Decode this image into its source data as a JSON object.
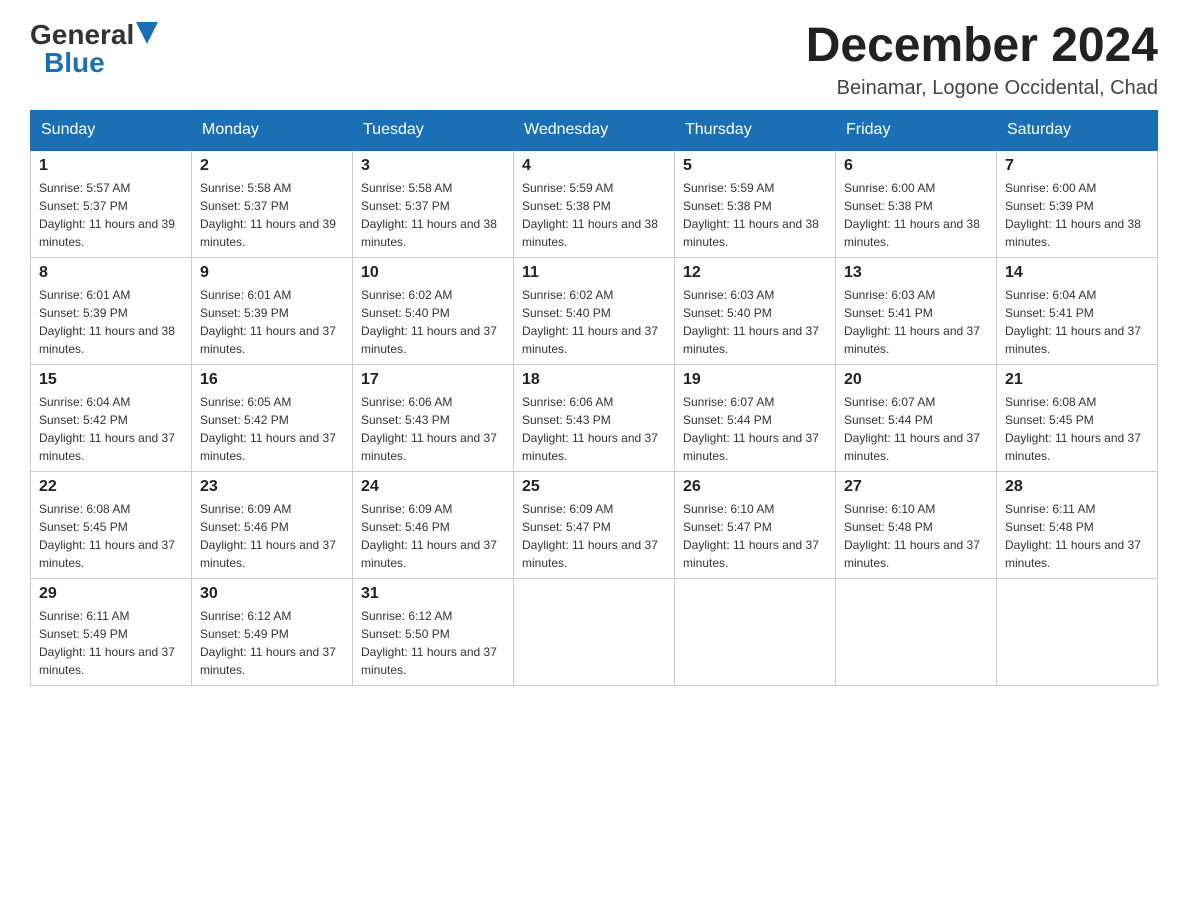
{
  "logo": {
    "general": "General",
    "blue": "Blue"
  },
  "title": "December 2024",
  "location": "Beinamar, Logone Occidental, Chad",
  "days_of_week": [
    "Sunday",
    "Monday",
    "Tuesday",
    "Wednesday",
    "Thursday",
    "Friday",
    "Saturday"
  ],
  "weeks": [
    [
      {
        "day": "1",
        "sunrise": "5:57 AM",
        "sunset": "5:37 PM",
        "daylight": "11 hours and 39 minutes."
      },
      {
        "day": "2",
        "sunrise": "5:58 AM",
        "sunset": "5:37 PM",
        "daylight": "11 hours and 39 minutes."
      },
      {
        "day": "3",
        "sunrise": "5:58 AM",
        "sunset": "5:37 PM",
        "daylight": "11 hours and 38 minutes."
      },
      {
        "day": "4",
        "sunrise": "5:59 AM",
        "sunset": "5:38 PM",
        "daylight": "11 hours and 38 minutes."
      },
      {
        "day": "5",
        "sunrise": "5:59 AM",
        "sunset": "5:38 PM",
        "daylight": "11 hours and 38 minutes."
      },
      {
        "day": "6",
        "sunrise": "6:00 AM",
        "sunset": "5:38 PM",
        "daylight": "11 hours and 38 minutes."
      },
      {
        "day": "7",
        "sunrise": "6:00 AM",
        "sunset": "5:39 PM",
        "daylight": "11 hours and 38 minutes."
      }
    ],
    [
      {
        "day": "8",
        "sunrise": "6:01 AM",
        "sunset": "5:39 PM",
        "daylight": "11 hours and 38 minutes."
      },
      {
        "day": "9",
        "sunrise": "6:01 AM",
        "sunset": "5:39 PM",
        "daylight": "11 hours and 37 minutes."
      },
      {
        "day": "10",
        "sunrise": "6:02 AM",
        "sunset": "5:40 PM",
        "daylight": "11 hours and 37 minutes."
      },
      {
        "day": "11",
        "sunrise": "6:02 AM",
        "sunset": "5:40 PM",
        "daylight": "11 hours and 37 minutes."
      },
      {
        "day": "12",
        "sunrise": "6:03 AM",
        "sunset": "5:40 PM",
        "daylight": "11 hours and 37 minutes."
      },
      {
        "day": "13",
        "sunrise": "6:03 AM",
        "sunset": "5:41 PM",
        "daylight": "11 hours and 37 minutes."
      },
      {
        "day": "14",
        "sunrise": "6:04 AM",
        "sunset": "5:41 PM",
        "daylight": "11 hours and 37 minutes."
      }
    ],
    [
      {
        "day": "15",
        "sunrise": "6:04 AM",
        "sunset": "5:42 PM",
        "daylight": "11 hours and 37 minutes."
      },
      {
        "day": "16",
        "sunrise": "6:05 AM",
        "sunset": "5:42 PM",
        "daylight": "11 hours and 37 minutes."
      },
      {
        "day": "17",
        "sunrise": "6:06 AM",
        "sunset": "5:43 PM",
        "daylight": "11 hours and 37 minutes."
      },
      {
        "day": "18",
        "sunrise": "6:06 AM",
        "sunset": "5:43 PM",
        "daylight": "11 hours and 37 minutes."
      },
      {
        "day": "19",
        "sunrise": "6:07 AM",
        "sunset": "5:44 PM",
        "daylight": "11 hours and 37 minutes."
      },
      {
        "day": "20",
        "sunrise": "6:07 AM",
        "sunset": "5:44 PM",
        "daylight": "11 hours and 37 minutes."
      },
      {
        "day": "21",
        "sunrise": "6:08 AM",
        "sunset": "5:45 PM",
        "daylight": "11 hours and 37 minutes."
      }
    ],
    [
      {
        "day": "22",
        "sunrise": "6:08 AM",
        "sunset": "5:45 PM",
        "daylight": "11 hours and 37 minutes."
      },
      {
        "day": "23",
        "sunrise": "6:09 AM",
        "sunset": "5:46 PM",
        "daylight": "11 hours and 37 minutes."
      },
      {
        "day": "24",
        "sunrise": "6:09 AM",
        "sunset": "5:46 PM",
        "daylight": "11 hours and 37 minutes."
      },
      {
        "day": "25",
        "sunrise": "6:09 AM",
        "sunset": "5:47 PM",
        "daylight": "11 hours and 37 minutes."
      },
      {
        "day": "26",
        "sunrise": "6:10 AM",
        "sunset": "5:47 PM",
        "daylight": "11 hours and 37 minutes."
      },
      {
        "day": "27",
        "sunrise": "6:10 AM",
        "sunset": "5:48 PM",
        "daylight": "11 hours and 37 minutes."
      },
      {
        "day": "28",
        "sunrise": "6:11 AM",
        "sunset": "5:48 PM",
        "daylight": "11 hours and 37 minutes."
      }
    ],
    [
      {
        "day": "29",
        "sunrise": "6:11 AM",
        "sunset": "5:49 PM",
        "daylight": "11 hours and 37 minutes."
      },
      {
        "day": "30",
        "sunrise": "6:12 AM",
        "sunset": "5:49 PM",
        "daylight": "11 hours and 37 minutes."
      },
      {
        "day": "31",
        "sunrise": "6:12 AM",
        "sunset": "5:50 PM",
        "daylight": "11 hours and 37 minutes."
      },
      null,
      null,
      null,
      null
    ]
  ]
}
